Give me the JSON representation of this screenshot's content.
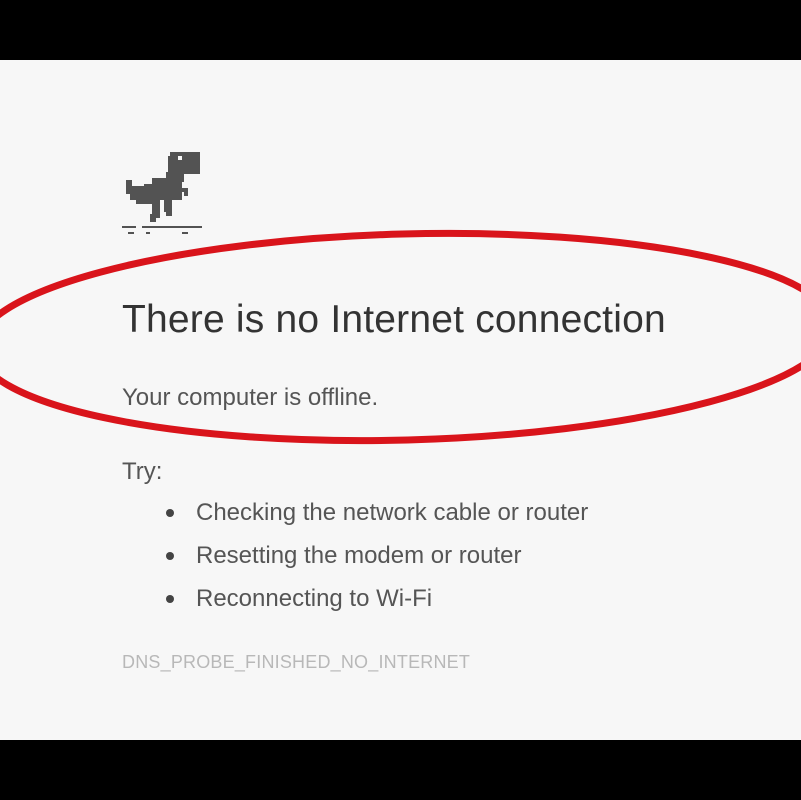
{
  "error_page": {
    "headline": "There is no Internet connection",
    "subline": "Your computer is offline.",
    "try_label": "Try:",
    "suggestions": [
      "Checking the network cable or router",
      "Resetting the modem or router",
      "Reconnecting to Wi-Fi"
    ],
    "error_code": "DNS_PROBE_FINISHED_NO_INTERNET",
    "icon": "offline-dinosaur-icon"
  },
  "colors": {
    "background": "#f7f7f7",
    "headline_text": "#333333",
    "body_text": "#555555",
    "error_code_text": "#b8b8b8",
    "dino": "#535353",
    "annotation_ellipse": "#d9141b",
    "letterbox": "#000000"
  }
}
